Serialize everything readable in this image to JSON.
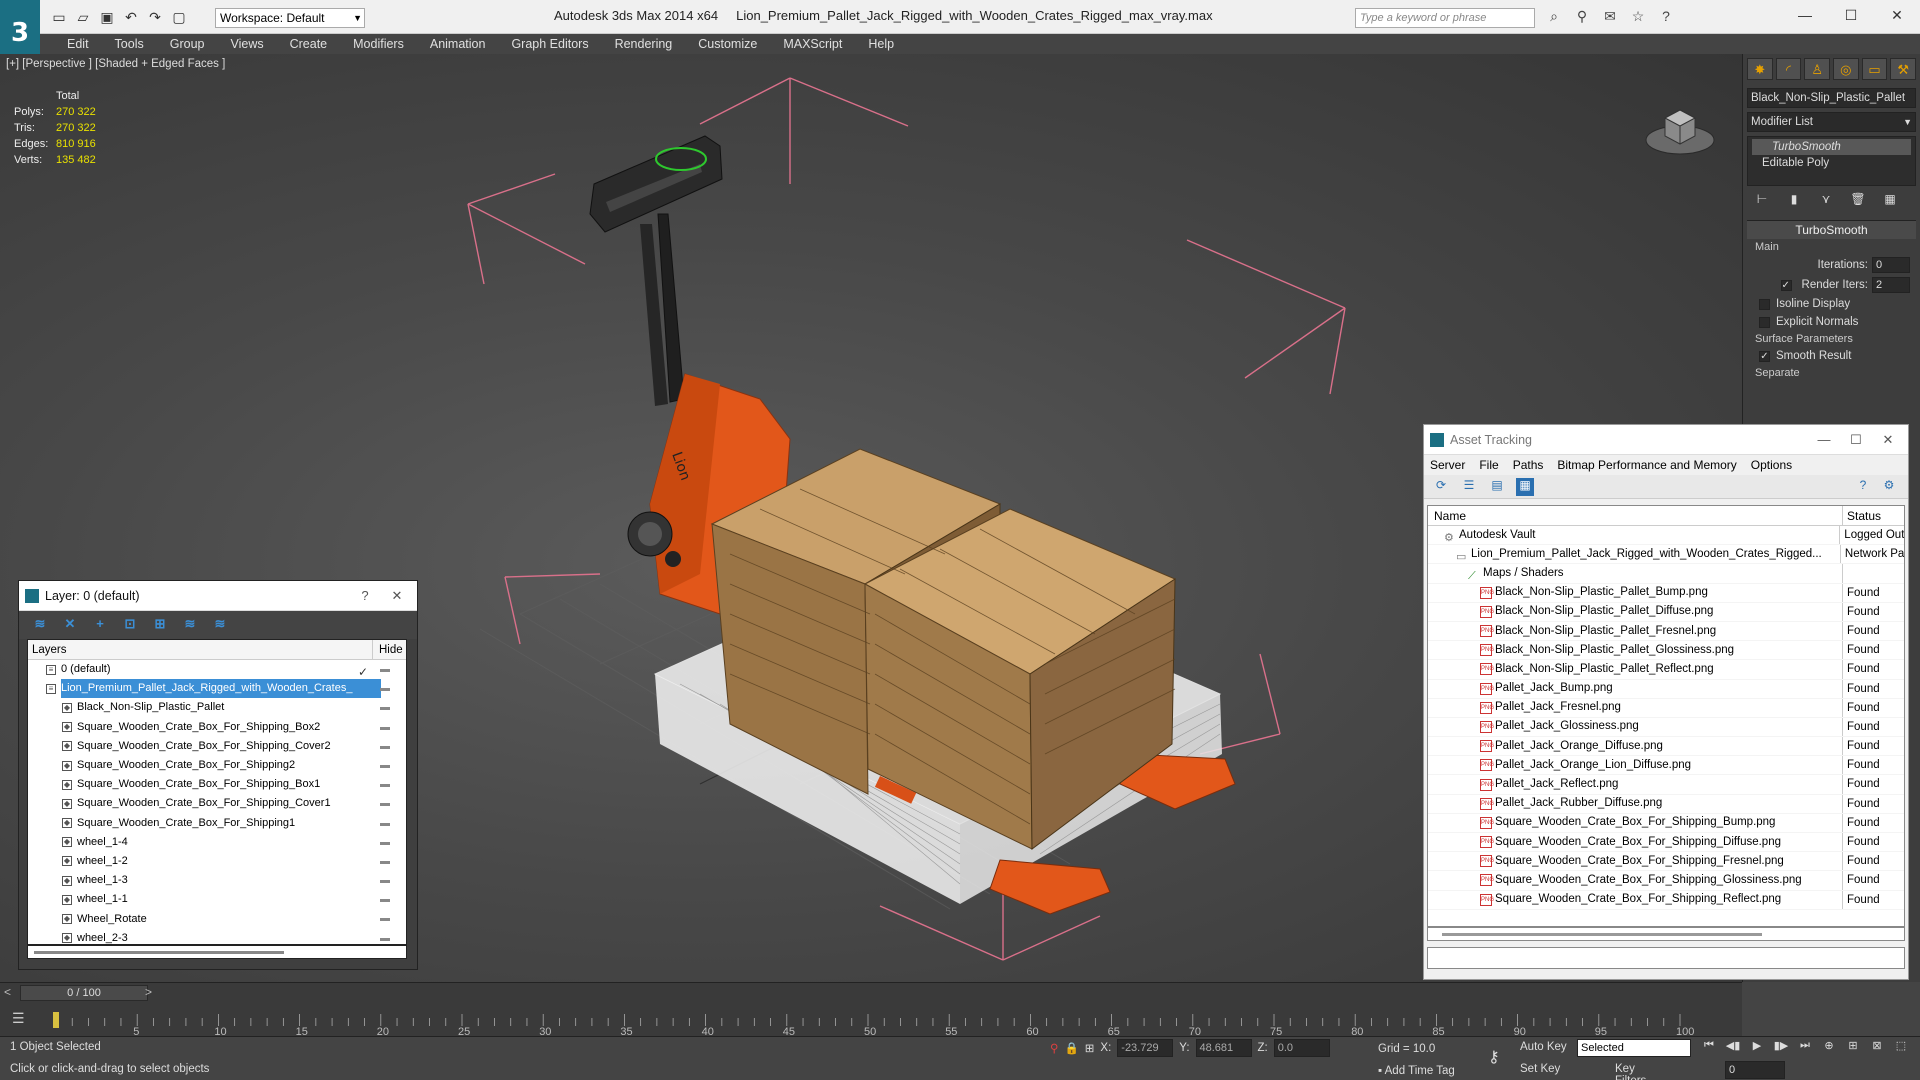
{
  "app": {
    "title": "Autodesk 3ds Max  2014 x64",
    "filename": "Lion_Premium_Pallet_Jack_Rigged_with_Wooden_Crates_Rigged_max_vray.max",
    "workspace": "Workspace: Default",
    "search_placeholder": "Type a keyword or phrase"
  },
  "menu": [
    "Edit",
    "Tools",
    "Group",
    "Views",
    "Create",
    "Modifiers",
    "Animation",
    "Graph Editors",
    "Rendering",
    "Customize",
    "MAXScript",
    "Help"
  ],
  "viewport": {
    "label": "[+] [Perspective ] [Shaded + Edged Faces ]",
    "stats_header": "Total",
    "stats": [
      {
        "label": "Polys:",
        "value": "270 322"
      },
      {
        "label": "Tris:",
        "value": "270 322"
      },
      {
        "label": "Edges:",
        "value": "810 916"
      },
      {
        "label": "Verts:",
        "value": "135 482"
      }
    ],
    "crate_logo": "Lion"
  },
  "command_panel": {
    "object_name": "Black_Non-Slip_Plastic_Pallet",
    "modifier_list": "Modifier List",
    "stack": [
      "TurboSmooth",
      "Editable Poly"
    ],
    "rollout_title": "TurboSmooth",
    "group_main": "Main",
    "iterations_label": "Iterations:",
    "iterations_value": "0",
    "render_iters_label": "Render Iters:",
    "render_iters_value": "2",
    "isoline": "Isoline Display",
    "explicit": "Explicit Normals",
    "surface_params": "Surface Parameters",
    "smooth_result": "Smooth Result",
    "separate": "Separate"
  },
  "layer_window": {
    "title": "Layer: 0 (default)",
    "help": "?",
    "col_layers": "Layers",
    "col_hide": "Hide",
    "rows": [
      {
        "name": "0 (default)",
        "indent": 1,
        "selected": false,
        "check": true
      },
      {
        "name": "Lion_Premium_Pallet_Jack_Rigged_with_Wooden_Crates_",
        "indent": 1,
        "selected": true,
        "check": false
      },
      {
        "name": "Black_Non-Slip_Plastic_Pallet",
        "indent": 2,
        "selected": false,
        "check": false
      },
      {
        "name": "Square_Wooden_Crate_Box_For_Shipping_Box2",
        "indent": 2,
        "selected": false,
        "check": false
      },
      {
        "name": "Square_Wooden_Crate_Box_For_Shipping_Cover2",
        "indent": 2,
        "selected": false,
        "check": false
      },
      {
        "name": "Square_Wooden_Crate_Box_For_Shipping2",
        "indent": 2,
        "selected": false,
        "check": false
      },
      {
        "name": "Square_Wooden_Crate_Box_For_Shipping_Box1",
        "indent": 2,
        "selected": false,
        "check": false
      },
      {
        "name": "Square_Wooden_Crate_Box_For_Shipping_Cover1",
        "indent": 2,
        "selected": false,
        "check": false
      },
      {
        "name": "Square_Wooden_Crate_Box_For_Shipping1",
        "indent": 2,
        "selected": false,
        "check": false
      },
      {
        "name": "wheel_1-4",
        "indent": 2,
        "selected": false,
        "check": false
      },
      {
        "name": "wheel_1-2",
        "indent": 2,
        "selected": false,
        "check": false
      },
      {
        "name": "wheel_1-3",
        "indent": 2,
        "selected": false,
        "check": false
      },
      {
        "name": "wheel_1-1",
        "indent": 2,
        "selected": false,
        "check": false
      },
      {
        "name": "Wheel_Rotate",
        "indent": 2,
        "selected": false,
        "check": false
      },
      {
        "name": "wheel_2-3",
        "indent": 2,
        "selected": false,
        "check": false
      }
    ]
  },
  "asset_window": {
    "title": "Asset Tracking",
    "menu": [
      "Server",
      "File",
      "Paths",
      "Bitmap Performance and Memory",
      "Options"
    ],
    "col_name": "Name",
    "col_status": "Status",
    "rows": [
      {
        "name": "Autodesk Vault",
        "status": "Logged Out",
        "type": "vault",
        "indent": 1
      },
      {
        "name": "Lion_Premium_Pallet_Jack_Rigged_with_Wooden_Crates_Rigged...",
        "status": "Network Pa",
        "type": "max",
        "indent": 2
      },
      {
        "name": "Maps / Shaders",
        "status": "",
        "type": "group",
        "indent": 3
      },
      {
        "name": "Black_Non-Slip_Plastic_Pallet_Bump.png",
        "status": "Found",
        "type": "file",
        "indent": 4
      },
      {
        "name": "Black_Non-Slip_Plastic_Pallet_Diffuse.png",
        "status": "Found",
        "type": "file",
        "indent": 4
      },
      {
        "name": "Black_Non-Slip_Plastic_Pallet_Fresnel.png",
        "status": "Found",
        "type": "file",
        "indent": 4
      },
      {
        "name": "Black_Non-Slip_Plastic_Pallet_Glossiness.png",
        "status": "Found",
        "type": "file",
        "indent": 4
      },
      {
        "name": "Black_Non-Slip_Plastic_Pallet_Reflect.png",
        "status": "Found",
        "type": "file",
        "indent": 4
      },
      {
        "name": "Pallet_Jack_Bump.png",
        "status": "Found",
        "type": "file",
        "indent": 4
      },
      {
        "name": "Pallet_Jack_Fresnel.png",
        "status": "Found",
        "type": "file",
        "indent": 4
      },
      {
        "name": "Pallet_Jack_Glossiness.png",
        "status": "Found",
        "type": "file",
        "indent": 4
      },
      {
        "name": "Pallet_Jack_Orange_Diffuse.png",
        "status": "Found",
        "type": "file",
        "indent": 4
      },
      {
        "name": "Pallet_Jack_Orange_Lion_Diffuse.png",
        "status": "Found",
        "type": "file",
        "indent": 4
      },
      {
        "name": "Pallet_Jack_Reflect.png",
        "status": "Found",
        "type": "file",
        "indent": 4
      },
      {
        "name": "Pallet_Jack_Rubber_Diffuse.png",
        "status": "Found",
        "type": "file",
        "indent": 4
      },
      {
        "name": "Square_Wooden_Crate_Box_For_Shipping_Bump.png",
        "status": "Found",
        "type": "file",
        "indent": 4
      },
      {
        "name": "Square_Wooden_Crate_Box_For_Shipping_Diffuse.png",
        "status": "Found",
        "type": "file",
        "indent": 4
      },
      {
        "name": "Square_Wooden_Crate_Box_For_Shipping_Fresnel.png",
        "status": "Found",
        "type": "file",
        "indent": 4
      },
      {
        "name": "Square_Wooden_Crate_Box_For_Shipping_Glossiness.png",
        "status": "Found",
        "type": "file",
        "indent": 4
      },
      {
        "name": "Square_Wooden_Crate_Box_For_Shipping_Reflect.png",
        "status": "Found",
        "type": "file",
        "indent": 4
      }
    ]
  },
  "timeline": {
    "frame": "0 / 100",
    "ticks": [
      "5",
      "10",
      "15",
      "20",
      "25",
      "30",
      "35",
      "40",
      "45",
      "50",
      "55",
      "60",
      "65",
      "70",
      "75",
      "80",
      "85",
      "90",
      "95",
      "100"
    ]
  },
  "status": {
    "selected": "1 Object Selected",
    "hint": "Click or click-and-drag to select objects",
    "x_label": "X:",
    "x": "-23.729",
    "y_label": "Y:",
    "y": "48.681",
    "z_label": "Z:",
    "z": "0.0",
    "grid": "Grid = 10.0",
    "add_time_tag": "Add Time Tag",
    "auto_key": "Auto Key",
    "set_key": "Set Key",
    "key_mode": "Selected",
    "key_filters": "Key Filters...",
    "frame_field": "0"
  }
}
